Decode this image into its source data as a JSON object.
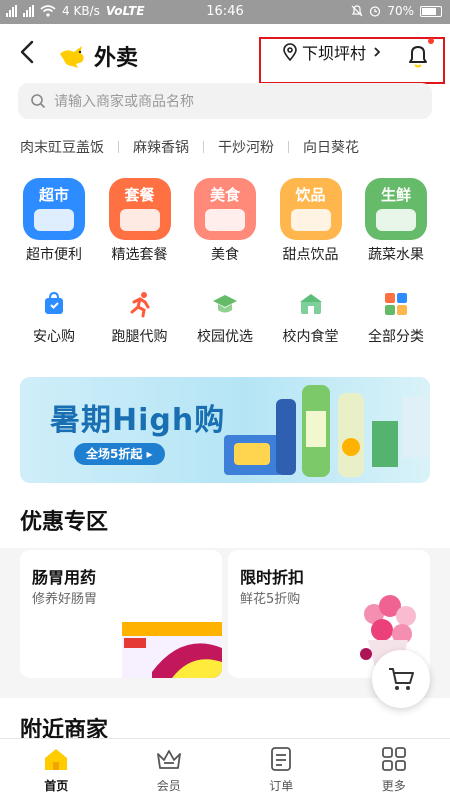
{
  "status_bar": {
    "network_speed": "4 KB/s",
    "volte": "VoLTE",
    "time": "16:46",
    "battery": "70%"
  },
  "header": {
    "title": "外卖",
    "location": "下坝坪村",
    "brand_color": "#ffcc00"
  },
  "search": {
    "placeholder": "请输入商家或商品名称"
  },
  "hot_words": [
    "肉末豇豆盖饭",
    "麻辣香锅",
    "干炒河粉",
    "向日葵花"
  ],
  "categories": [
    {
      "tile_text": "超市",
      "label": "超市便利",
      "color": "#2d8cff"
    },
    {
      "tile_text": "套餐",
      "label": "精选套餐",
      "color": "#ff7043"
    },
    {
      "tile_text": "美食",
      "label": "美食",
      "color": "#ff8a7a"
    },
    {
      "tile_text": "饮品",
      "label": "甜点饮品",
      "color": "#ffb74d"
    },
    {
      "tile_text": "生鲜",
      "label": "蔬菜水果",
      "color": "#66bb6a"
    }
  ],
  "sub_categories": [
    {
      "label": "安心购",
      "icon": "shield-bag-icon"
    },
    {
      "label": "跑腿代购",
      "icon": "runner-icon"
    },
    {
      "label": "校园优选",
      "icon": "graduation-cap-icon"
    },
    {
      "label": "校内食堂",
      "icon": "canteen-icon"
    },
    {
      "label": "全部分类",
      "icon": "grid-icon"
    }
  ],
  "banner": {
    "title": "暑期High购",
    "pill": "全场5折起 ▸"
  },
  "promo_section": {
    "title": "优惠专区",
    "cards": [
      {
        "title": "肠胃用药",
        "subtitle": "修养好肠胃"
      },
      {
        "title": "限时折扣",
        "subtitle": "鲜花5折购"
      }
    ]
  },
  "nearby": {
    "title": "附近商家"
  },
  "tabbar": {
    "items": [
      {
        "label": "首页",
        "icon": "home-icon",
        "active": true
      },
      {
        "label": "会员",
        "icon": "crown-icon",
        "active": false
      },
      {
        "label": "订单",
        "icon": "order-icon",
        "active": false
      },
      {
        "label": "更多",
        "icon": "more-grid-icon",
        "active": false
      }
    ]
  }
}
